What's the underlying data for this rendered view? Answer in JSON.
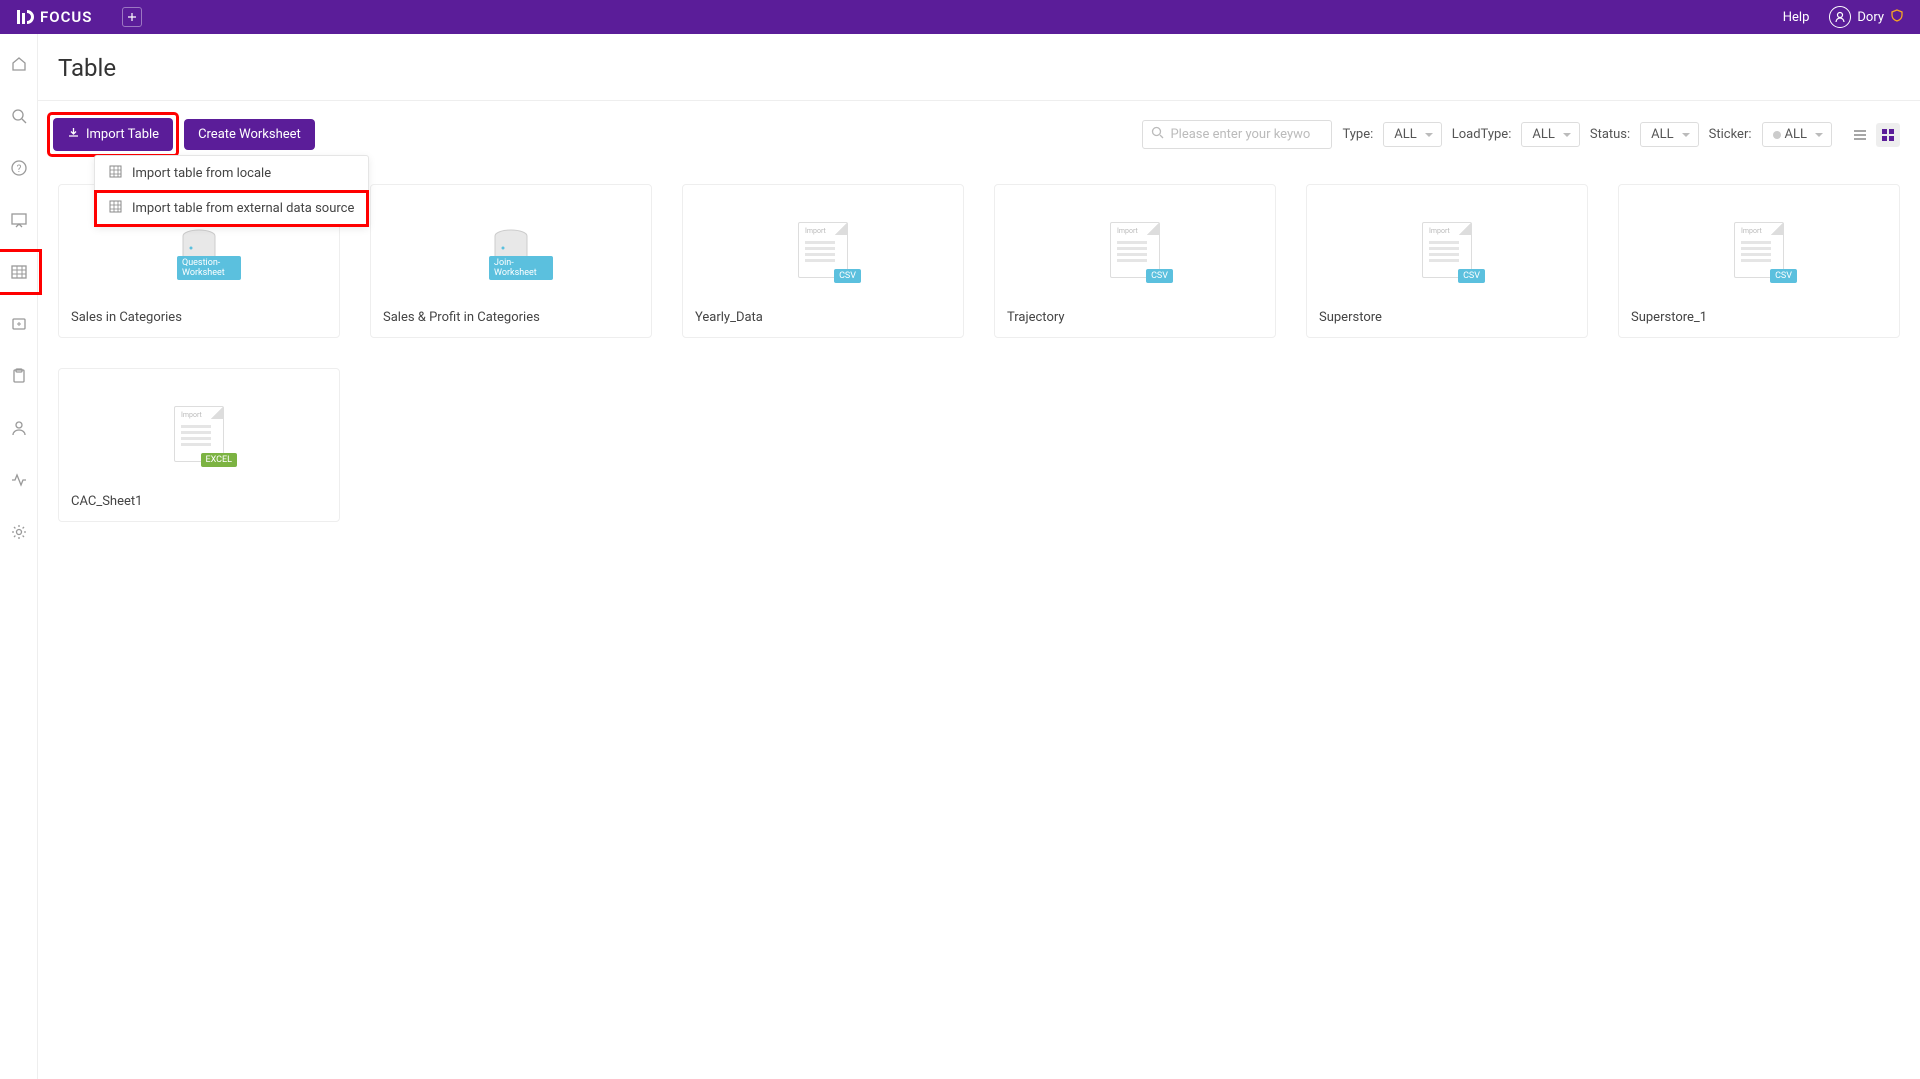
{
  "header": {
    "brand": "FOCUS",
    "help": "Help",
    "user": "Dory"
  },
  "page": {
    "title": "Table"
  },
  "toolbar": {
    "import_label": "Import Table",
    "create_worksheet_label": "Create Worksheet",
    "search_placeholder": "Please enter your keywo",
    "filters": {
      "type_label": "Type:",
      "type_value": "ALL",
      "loadtype_label": "LoadType:",
      "loadtype_value": "ALL",
      "status_label": "Status:",
      "status_value": "ALL",
      "sticker_label": "Sticker:",
      "sticker_value": "ALL"
    }
  },
  "dropdown": {
    "items": [
      {
        "label": "Import table from locale"
      },
      {
        "label": "Import table from external data source"
      }
    ]
  },
  "cards": [
    {
      "title": "Sales in Categories",
      "type": "db",
      "badge": "Question-Worksheet",
      "badge_class": "badge-cyan"
    },
    {
      "title": "Sales & Profit in Categories",
      "type": "db",
      "badge": "Join-Worksheet",
      "badge_class": "badge-cyan"
    },
    {
      "title": "Yearly_Data",
      "type": "doc",
      "badge": "CSV",
      "badge_class": "badge-cyan"
    },
    {
      "title": "Trajectory",
      "type": "doc",
      "badge": "CSV",
      "badge_class": "badge-cyan"
    },
    {
      "title": "Superstore",
      "type": "doc",
      "badge": "CSV",
      "badge_class": "badge-cyan"
    },
    {
      "title": "Superstore_1",
      "type": "doc",
      "badge": "CSV",
      "badge_class": "badge-cyan"
    },
    {
      "title": "CAC_Sheet1",
      "type": "doc",
      "badge": "EXCEL",
      "badge_class": "badge-green"
    }
  ]
}
